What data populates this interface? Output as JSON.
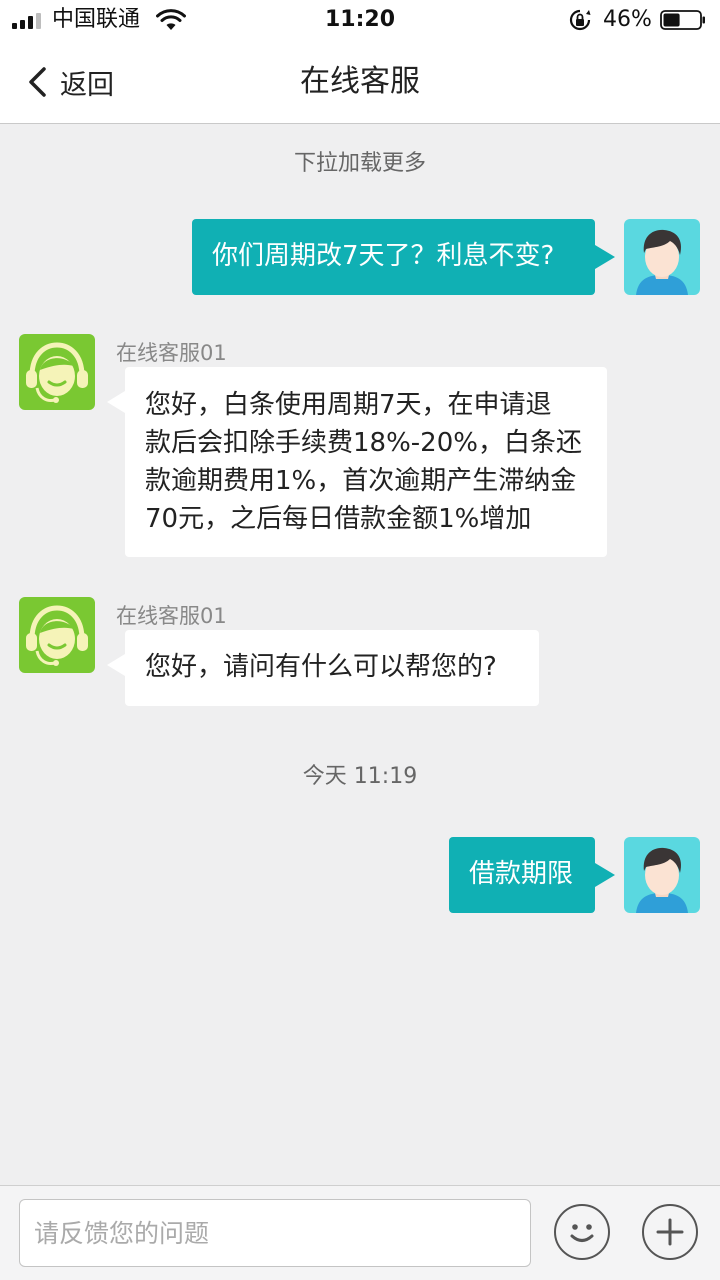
{
  "status_bar": {
    "carrier": "中国联通",
    "time": "11:20",
    "battery_percent": "46%",
    "battery_level": 0.46
  },
  "nav": {
    "back_label": "返回",
    "title": "在线客服"
  },
  "chat": {
    "pull_tip": "下拉加载更多",
    "messages": [
      {
        "from": "user",
        "text": "你们周期改7天了？利息不变?"
      },
      {
        "from": "agent",
        "name": "在线客服01",
        "lines": [
          "您好，白条使用周期7天，在申请退",
          "款后会扣除手续费18%-20%，白条还",
          "款逾期费用1%，首次逾期产生滞纳金",
          "70元，之后每日借款金额1%增加"
        ]
      },
      {
        "from": "agent",
        "name": "在线客服01",
        "text": "您好，请问有什么可以帮您的?"
      },
      {
        "from": "user",
        "text": "借款期限"
      }
    ],
    "timestamp": "今天 11:19"
  },
  "input": {
    "placeholder": "请反馈您的问题",
    "value": ""
  },
  "icons": {
    "back": "chevron-left-icon",
    "emoji": "smiley-icon",
    "more": "plus-icon",
    "user_avatar": "user-avatar-icon",
    "agent_avatar": "agent-avatar-icon"
  },
  "colors": {
    "user_bubble": "#10b0b4",
    "agent_bubble": "#ffffff",
    "background": "#efeff0",
    "agent_avatar_bg": "#7ac832",
    "user_avatar_bg": "#5ad8e0"
  }
}
